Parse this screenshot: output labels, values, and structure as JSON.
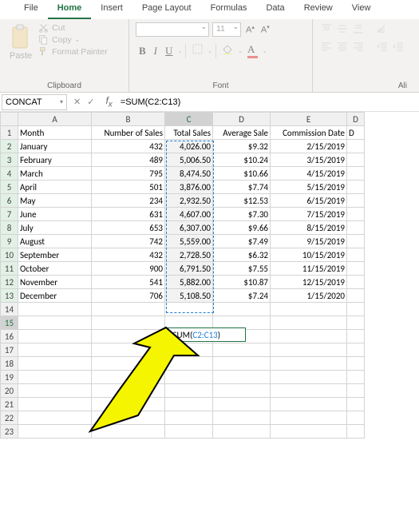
{
  "tabs": [
    "File",
    "Home",
    "Insert",
    "Page Layout",
    "Formulas",
    "Data",
    "Review",
    "View"
  ],
  "active_tab": "Home",
  "clipboard": {
    "cut": "Cut",
    "copy": "Copy",
    "fp": "Format Painter",
    "paste": "Paste",
    "group": "Clipboard"
  },
  "font": {
    "size": "11",
    "group": "Font",
    "bold": "B",
    "italic": "I",
    "underline": "U"
  },
  "align": {
    "group": "Ali"
  },
  "namebox": "CONCAT",
  "formula_bar": "=SUM(C2:C13)",
  "cols": [
    "A",
    "B",
    "C",
    "D",
    "E",
    "D"
  ],
  "header_row": [
    "Month",
    "Number of Sales",
    "Total Sales",
    "Average Sale",
    "Commission Date",
    "D"
  ],
  "rows": [
    {
      "m": "January",
      "n": "432",
      "t": "4,026.00",
      "a": "$9.32",
      "c": "2/15/2019"
    },
    {
      "m": "February",
      "n": "489",
      "t": "5,006.50",
      "a": "$10.24",
      "c": "3/15/2019"
    },
    {
      "m": "March",
      "n": "795",
      "t": "8,474.50",
      "a": "$10.66",
      "c": "4/15/2019"
    },
    {
      "m": "April",
      "n": "501",
      "t": "3,876.00",
      "a": "$7.74",
      "c": "5/15/2019"
    },
    {
      "m": "May",
      "n": "234",
      "t": "2,932.50",
      "a": "$12.53",
      "c": "6/15/2019"
    },
    {
      "m": "June",
      "n": "631",
      "t": "4,607.00",
      "a": "$7.30",
      "c": "7/15/2019"
    },
    {
      "m": "July",
      "n": "653",
      "t": "6,307.00",
      "a": "$9.66",
      "c": "8/15/2019"
    },
    {
      "m": "August",
      "n": "742",
      "t": "5,559.00",
      "a": "$7.49",
      "c": "9/15/2019"
    },
    {
      "m": "September",
      "n": "432",
      "t": "2,728.50",
      "a": "$6.32",
      "c": "10/15/2019"
    },
    {
      "m": "October",
      "n": "900",
      "t": "6,791.50",
      "a": "$7.55",
      "c": "11/15/2019"
    },
    {
      "m": "November",
      "n": "541",
      "t": "5,882.00",
      "a": "$10.87",
      "c": "12/15/2019"
    },
    {
      "m": "December",
      "n": "706",
      "t": "5,108.50",
      "a": "$7.24",
      "c": "1/15/2020"
    }
  ],
  "empty_rows": [
    14,
    15,
    16,
    17,
    18,
    19,
    20,
    21,
    22,
    23
  ],
  "active_cell_text_prefix": "=SUM(",
  "active_cell_text_ref": "C2:C13",
  "active_cell_text_suffix": ")",
  "chart_data": {
    "type": "table",
    "columns": [
      "Month",
      "Number of Sales",
      "Total Sales",
      "Average Sale",
      "Commission Date"
    ],
    "rows": [
      [
        "January",
        432,
        4026.0,
        9.32,
        "2/15/2019"
      ],
      [
        "February",
        489,
        5006.5,
        10.24,
        "3/15/2019"
      ],
      [
        "March",
        795,
        8474.5,
        10.66,
        "4/15/2019"
      ],
      [
        "April",
        501,
        3876.0,
        7.74,
        "5/15/2019"
      ],
      [
        "May",
        234,
        2932.5,
        12.53,
        "6/15/2019"
      ],
      [
        "June",
        631,
        4607.0,
        7.3,
        "7/15/2019"
      ],
      [
        "July",
        653,
        6307.0,
        9.66,
        "8/15/2019"
      ],
      [
        "August",
        742,
        5559.0,
        7.49,
        "9/15/2019"
      ],
      [
        "September",
        432,
        2728.5,
        6.32,
        "10/15/2019"
      ],
      [
        "October",
        900,
        6791.5,
        7.55,
        "11/15/2019"
      ],
      [
        "November",
        541,
        5882.0,
        10.87,
        "12/15/2019"
      ],
      [
        "December",
        706,
        5108.5,
        7.24,
        "1/15/2020"
      ]
    ]
  }
}
